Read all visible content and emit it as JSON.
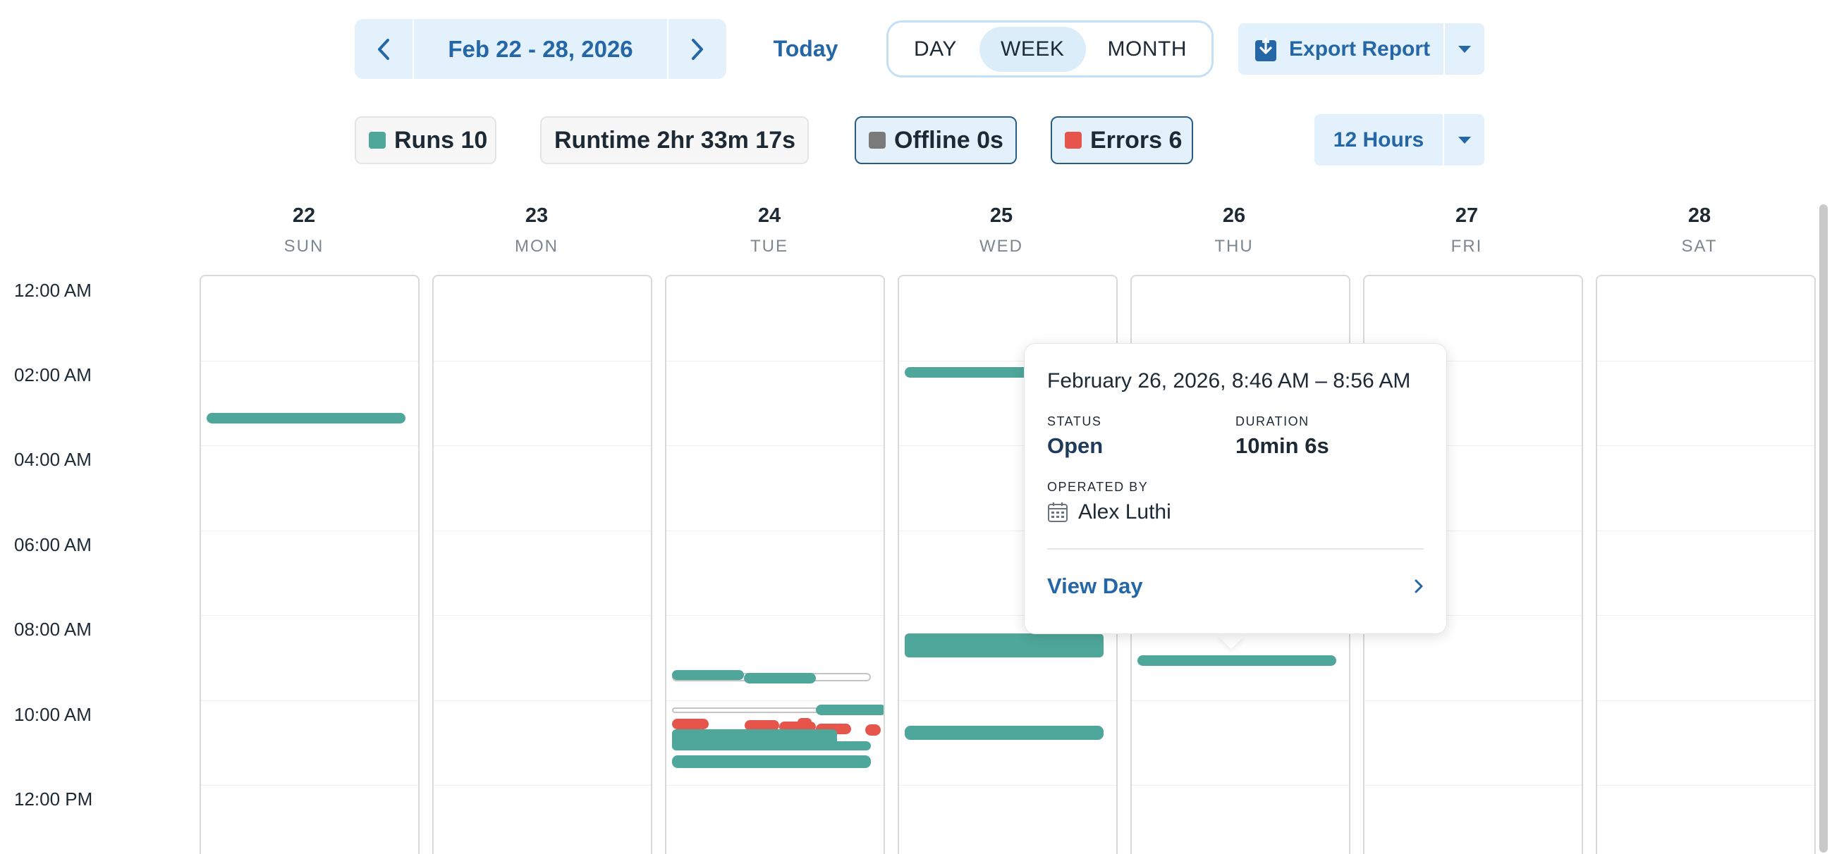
{
  "toolbar": {
    "date_range": "Feb 22 - 28, 2026",
    "today_label": "Today",
    "views": {
      "day": "DAY",
      "week": "WEEK",
      "month": "MONTH",
      "selected": "WEEK"
    },
    "export_label": "Export Report",
    "interval_label": "12 Hours"
  },
  "stats": {
    "runs": {
      "label": "Runs",
      "value": "10",
      "color": "#4ea79a"
    },
    "runtime": {
      "label": "Runtime",
      "value": "2hr 33m 17s"
    },
    "offline": {
      "label": "Offline",
      "value": "0s",
      "color": "#7a7a7a"
    },
    "errors": {
      "label": "Errors",
      "value": "6",
      "color": "#e5554b"
    }
  },
  "days": [
    {
      "num": "22",
      "name": "SUN"
    },
    {
      "num": "23",
      "name": "MON"
    },
    {
      "num": "24",
      "name": "TUE"
    },
    {
      "num": "25",
      "name": "WED"
    },
    {
      "num": "26",
      "name": "THU"
    },
    {
      "num": "27",
      "name": "FRI"
    },
    {
      "num": "28",
      "name": "SAT"
    }
  ],
  "time_labels": [
    "12:00 AM",
    "02:00 AM",
    "04:00 AM",
    "06:00 AM",
    "08:00 AM",
    "10:00 AM",
    "12:00 PM"
  ],
  "popover": {
    "title": "February 26, 2026, 8:46 AM – 8:56 AM",
    "status_key": "STATUS",
    "status_value": "Open",
    "duration_key": "DURATION",
    "duration_value": "10min 6s",
    "operator_key": "OPERATED BY",
    "operator_name": "Alex Luthi",
    "link_label": "View Day"
  },
  "colors": {
    "run": "#4ea79a",
    "error": "#e5554b",
    "accent": "#2566a6",
    "accent_bg": "#e2f1fc"
  }
}
